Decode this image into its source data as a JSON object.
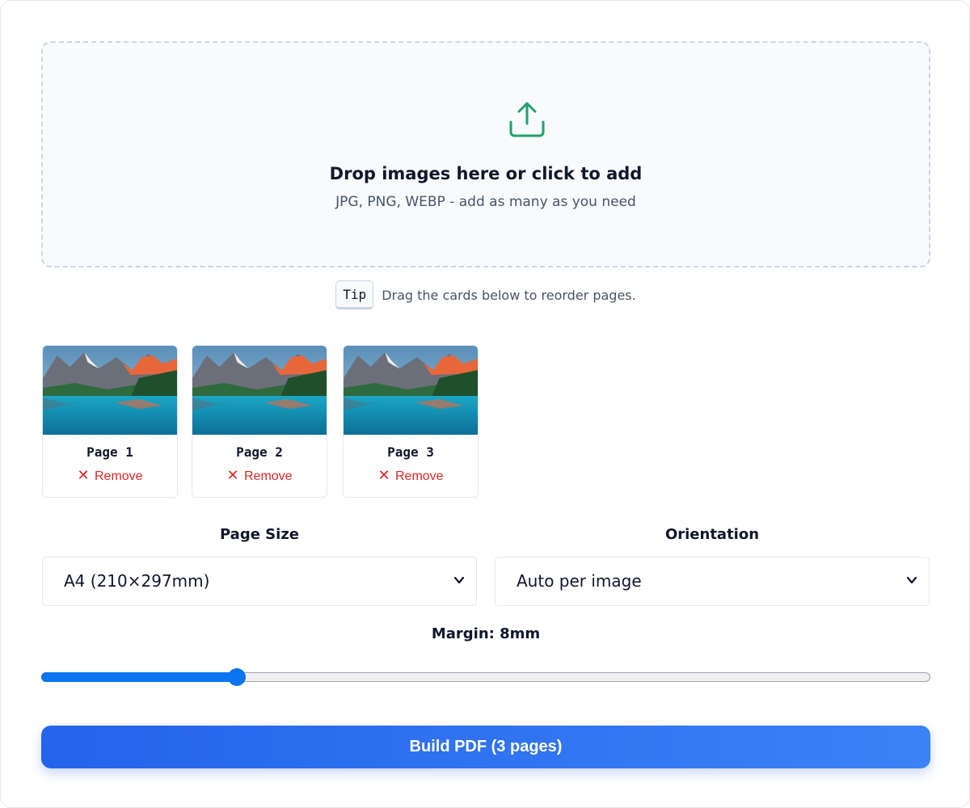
{
  "dropzone": {
    "icon": "upload-icon",
    "title": "Drop images here or click to add",
    "subtitle": "JPG, PNG, WEBP - add as many as you need"
  },
  "tip": {
    "badge": "Tip",
    "text": "Drag the cards below to reorder pages."
  },
  "pages": [
    {
      "label": "Page 1",
      "remove": "Remove"
    },
    {
      "label": "Page 2",
      "remove": "Remove"
    },
    {
      "label": "Page 3",
      "remove": "Remove"
    }
  ],
  "settings": {
    "page_size": {
      "label": "Page Size",
      "value": "A4 (210×297mm)"
    },
    "orientation": {
      "label": "Orientation",
      "value": "Auto per image"
    },
    "margin": {
      "label": "Margin: 8mm",
      "value": 8,
      "fraction": 0.22
    }
  },
  "build_button": "Build PDF (3 pages)",
  "colors": {
    "accent": "#2563eb",
    "icon": "#22a06b",
    "danger": "#dc2626",
    "slider": "#0b75f0"
  }
}
